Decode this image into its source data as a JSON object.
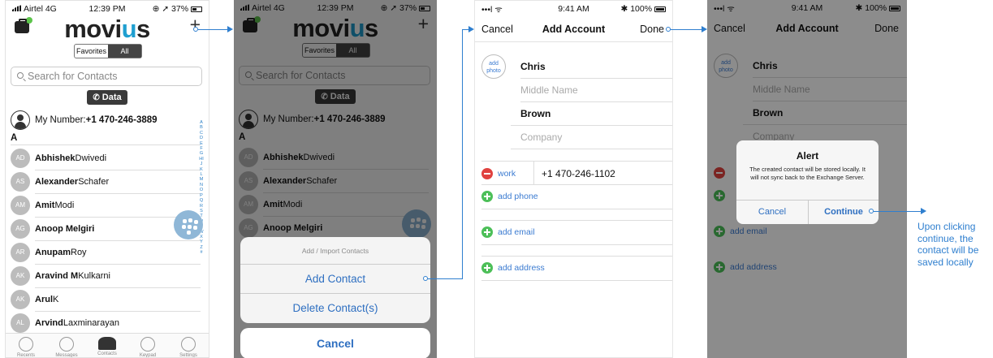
{
  "colors": {
    "accent": "#2e6fc1",
    "arrow": "#2f7fcf",
    "add_green": "#4cbf58",
    "delete_red": "#e0423f"
  },
  "screen1": {
    "status": {
      "carrier": "Airtel  4G",
      "time": "12:39 PM",
      "right": "⊕ ➚ 37%"
    },
    "logo": {
      "pre": "movi",
      "u": "u",
      "post": "s"
    },
    "plus_icon": "+",
    "segments": {
      "favorites": "Favorites",
      "all": "All"
    },
    "search_placeholder": "Search for Contacts",
    "data_button": "Data",
    "my_number": {
      "label": "My Number: ",
      "value": "+1 470-246-3889"
    },
    "section": "A",
    "contacts": [
      {
        "initials": "AD",
        "first": "Abhishek",
        "last": " Dwivedi"
      },
      {
        "initials": "AS",
        "first": "Alexander",
        "last": " Schafer"
      },
      {
        "initials": "AM",
        "first": "Amit",
        "last": " Modi"
      },
      {
        "initials": "AG",
        "first": "Anoop Melgiri",
        "last": ""
      },
      {
        "initials": "AR",
        "first": "Anupam",
        "last": " Roy"
      },
      {
        "initials": "AK",
        "first": "Aravind M",
        "last": " Kulkarni"
      },
      {
        "initials": "AK",
        "first": "Arul",
        "last": " K"
      },
      {
        "initials": "AL",
        "first": "Arvind",
        "last": " Laxminarayan"
      }
    ],
    "alphabet": "ABCDEFGHIJKLMNOPQRSTUVWXYZ#",
    "tabs": [
      "Recents",
      "Messages",
      "Contacts",
      "Keypad",
      "Settings"
    ]
  },
  "screen2": {
    "status": {
      "carrier": "Airtel  4G",
      "time": "12:39 PM",
      "right": "⊕ ➚ 37%"
    },
    "sheet": {
      "title": "Add / Import Contacts",
      "add": "Add Contact",
      "delete": "Delete Contact(s)",
      "cancel": "Cancel"
    }
  },
  "screen3": {
    "status": {
      "left": "•••l ᯤ",
      "time": "9:41 AM",
      "right": "✱ 100%"
    },
    "nav": {
      "cancel": "Cancel",
      "title": "Add Account",
      "done": "Done"
    },
    "add_photo": "add photo",
    "first": "Chris",
    "middle_placeholder": "Middle Name",
    "last": "Brown",
    "company_placeholder": "Company",
    "phone_label": "work",
    "phone_value": "+1 470-246-1102",
    "add_phone": "add phone",
    "add_email": "add email",
    "add_address": "add address"
  },
  "screen4": {
    "alert": {
      "title": "Alert",
      "message": "The created contact will be stored locally. It will not sync back to the Exchange Server.",
      "cancel": "Cancel",
      "continue": "Continue"
    }
  },
  "annotation": "Upon clicking continue, the contact will be saved locally"
}
